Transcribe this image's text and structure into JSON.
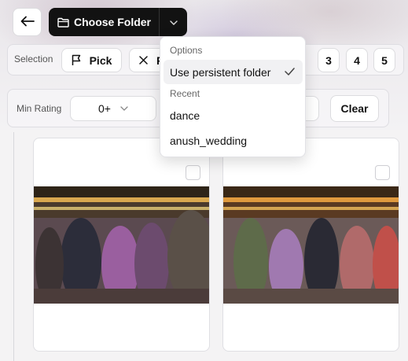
{
  "toolbar": {
    "back_icon": "arrow-left-icon",
    "choose_folder_label": "Choose Folder",
    "folder_icon": "folder-icon",
    "dropdown_icon": "chevron-down-icon"
  },
  "selection_row": {
    "label": "Selection",
    "pick_label": "Pick",
    "reject_label": "R",
    "ratings": [
      "3",
      "4",
      "5"
    ]
  },
  "filter_row": {
    "min_rating_label": "Min Rating",
    "min_rating_value": "0+",
    "clear_label": "Clear"
  },
  "dropdown": {
    "options_heading": "Options",
    "persistent_label": "Use persistent folder",
    "persistent_checked": true,
    "recent_heading": "Recent",
    "recent_items": [
      "dance",
      "anush_wedding"
    ]
  },
  "gallery": {
    "photos": [
      {
        "selected": false
      },
      {
        "selected": false
      }
    ]
  }
}
